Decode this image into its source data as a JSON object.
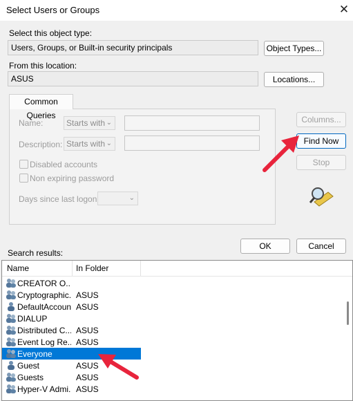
{
  "window": {
    "title": "Select Users or Groups"
  },
  "object_type": {
    "label": "Select this object type:",
    "value": "Users, Groups, or Built-in security principals",
    "button": "Object Types..."
  },
  "location": {
    "label": "From this location:",
    "value": "ASUS",
    "button": "Locations..."
  },
  "queries": {
    "tab": "Common Queries",
    "name_label": "Name:",
    "description_label": "Description:",
    "starts_with": "Starts with",
    "disabled_accounts": "Disabled accounts",
    "non_expiring": "Non expiring password",
    "days_label": "Days since last logon:"
  },
  "buttons": {
    "columns": "Columns...",
    "find_now": "Find Now",
    "stop": "Stop",
    "ok": "OK",
    "cancel": "Cancel"
  },
  "results": {
    "label": "Search results:",
    "columns": [
      "Name",
      "In Folder"
    ],
    "rows": [
      {
        "name": "CREATOR O...",
        "folder": ""
      },
      {
        "name": "Cryptographic...",
        "folder": "ASUS"
      },
      {
        "name": "DefaultAccount",
        "folder": "ASUS"
      },
      {
        "name": "DIALUP",
        "folder": ""
      },
      {
        "name": "Distributed C...",
        "folder": "ASUS"
      },
      {
        "name": "Event Log Re...",
        "folder": "ASUS"
      },
      {
        "name": "Everyone",
        "folder": ""
      },
      {
        "name": "Guest",
        "folder": "ASUS"
      },
      {
        "name": "Guests",
        "folder": "ASUS"
      },
      {
        "name": "Hyper-V Admi...",
        "folder": "ASUS"
      }
    ],
    "selected_index": 6
  },
  "colors": {
    "accent": "#0078d7",
    "annotation_arrow": "#e8243c"
  },
  "icons": {
    "close": "close-icon",
    "search": "search-magnifier-icon",
    "group": "group-icon",
    "user": "user-icon"
  }
}
